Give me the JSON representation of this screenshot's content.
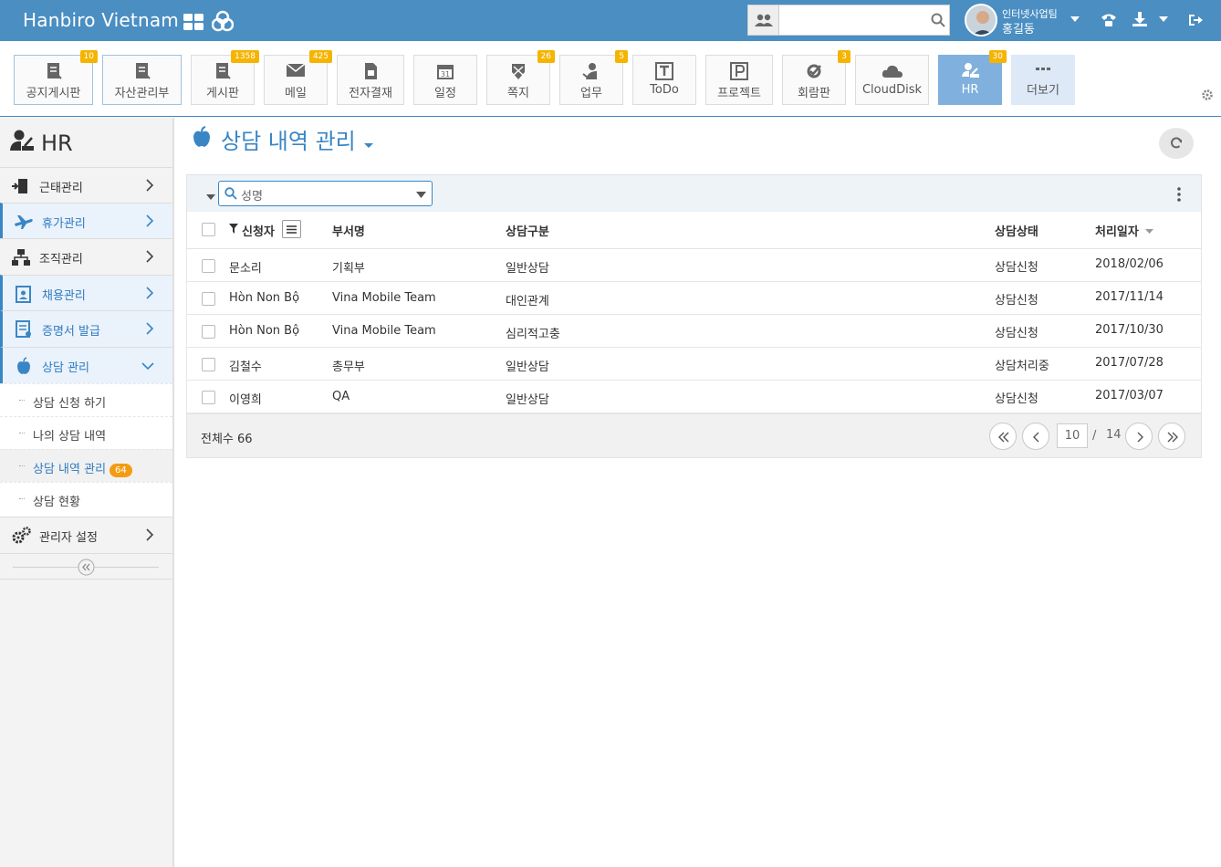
{
  "topbar": {
    "brand": "Hanbiro Vietnam",
    "search_placeholder": "",
    "user_team": "인터넷사업팀",
    "user_name": "홍길동"
  },
  "apps": [
    {
      "label": "공지게시판",
      "badge": "10"
    },
    {
      "label": "자산관리부",
      "badge": ""
    },
    {
      "label": "게시판",
      "badge": "1358"
    },
    {
      "label": "메일",
      "badge": "425"
    },
    {
      "label": "전자결재",
      "badge": ""
    },
    {
      "label": "일정",
      "badge": ""
    },
    {
      "label": "쪽지",
      "badge": "26"
    },
    {
      "label": "업무",
      "badge": "5"
    },
    {
      "label": "ToDo",
      "badge": ""
    },
    {
      "label": "프로젝트",
      "badge": ""
    },
    {
      "label": "회람판",
      "badge": "3"
    },
    {
      "label": "CloudDisk",
      "badge": ""
    },
    {
      "label": "HR",
      "badge": "30"
    },
    {
      "label": "더보기",
      "badge": ""
    }
  ],
  "sidebar": {
    "title": "HR",
    "items": [
      {
        "label": "근태관리"
      },
      {
        "label": "휴가관리"
      },
      {
        "label": "조직관리"
      },
      {
        "label": "채용관리"
      },
      {
        "label": "증명서 발급"
      },
      {
        "label": "상담 관리"
      }
    ],
    "subitems": [
      {
        "label": "상담 신청 하기"
      },
      {
        "label": "나의 상담 내역"
      },
      {
        "label": "상담 내역 관리",
        "count": "64"
      },
      {
        "label": "상담 현황"
      }
    ],
    "admin_label": "관리자 설정"
  },
  "main": {
    "title": "상담 내역 관리",
    "filter_placeholder": "성명",
    "columns": [
      "신청자",
      "부서명",
      "상담구분",
      "상담상태",
      "처리일자"
    ],
    "rows": [
      {
        "applicant": "문소리",
        "dept": "기획부",
        "type": "일반상담",
        "status": "상담신청",
        "date": "2018/02/06"
      },
      {
        "applicant": "Hòn Non Bộ",
        "dept": "Vina Mobile Team",
        "type": "대인관계",
        "status": "상담신청",
        "date": "2017/11/14"
      },
      {
        "applicant": "Hòn Non Bộ",
        "dept": "Vina Mobile Team",
        "type": "심리적고충",
        "status": "상담신청",
        "date": "2017/10/30"
      },
      {
        "applicant": "김철수",
        "dept": "총무부",
        "type": "일반상담",
        "status": "상담처리중",
        "date": "2017/07/28"
      },
      {
        "applicant": "이영희",
        "dept": "QA",
        "type": "일반상담",
        "status": "상담신청",
        "date": "2017/03/07"
      }
    ],
    "total_label": "전체수 66",
    "pagination": {
      "current": "10",
      "slash": "/",
      "total": "14"
    }
  },
  "colors": {
    "primary": "#4a8ec2",
    "accent": "#3a86c4",
    "badge": "#f5b400",
    "count": "#f39c12"
  }
}
